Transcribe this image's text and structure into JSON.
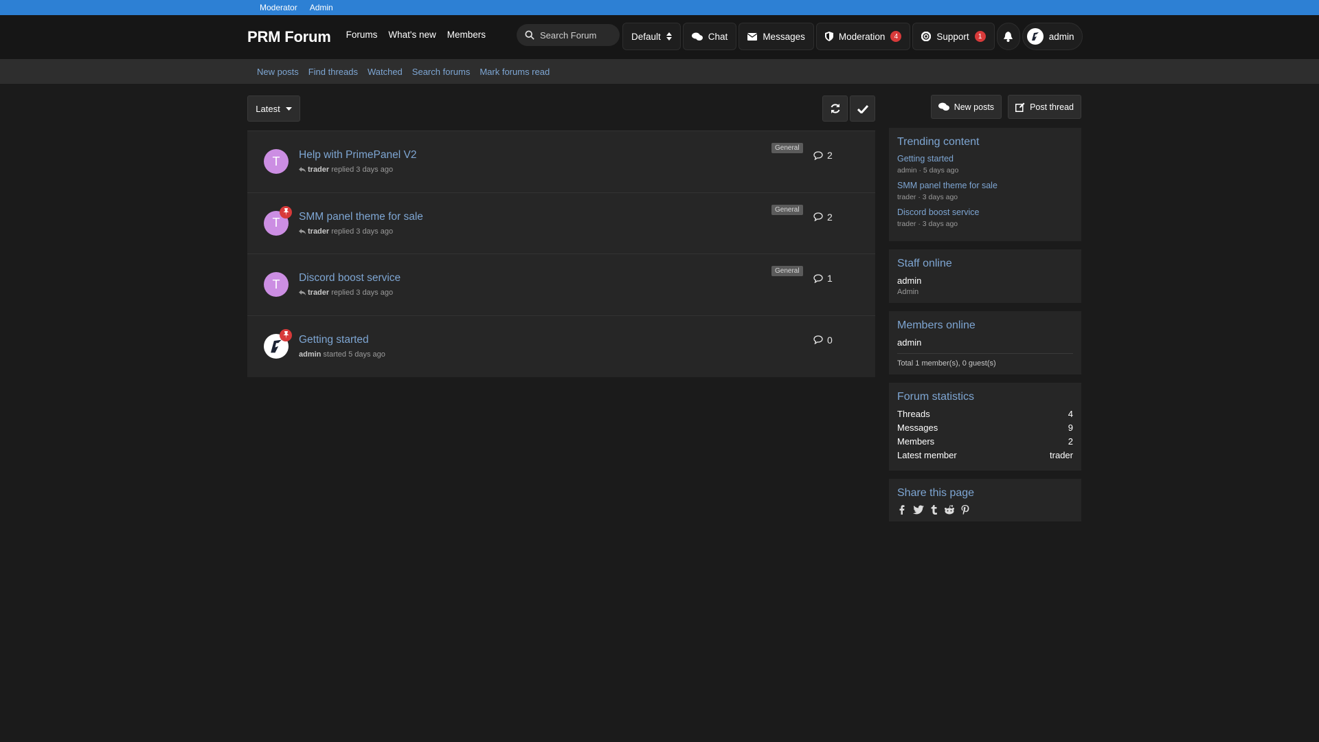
{
  "adminbar": {
    "moderator": "Moderator",
    "admin": "Admin"
  },
  "header": {
    "logo": "PRM Forum",
    "nav": [
      "Forums",
      "What's new",
      "Members"
    ],
    "search_placeholder": "Search Forum",
    "style": "Default",
    "chat": "Chat",
    "messages": "Messages",
    "moderation": "Moderation",
    "moderation_count": "4",
    "support": "Support",
    "support_count": "1",
    "user": "admin"
  },
  "subnav": [
    "New posts",
    "Find threads",
    "Watched",
    "Search forums",
    "Mark forums read"
  ],
  "toolbar": {
    "sort": "Latest"
  },
  "threads": [
    {
      "avatar": "T",
      "title": "Help with PrimePanel V2",
      "user": "trader",
      "action": "replied 3 days ago",
      "prefix": "General",
      "replies": "2"
    },
    {
      "avatar": "T",
      "title": "SMM panel theme for sale",
      "user": "trader",
      "action": "replied 3 days ago",
      "prefix": "General",
      "replies": "2"
    },
    {
      "avatar": "T",
      "title": "Discord boost service",
      "user": "trader",
      "action": "replied 3 days ago",
      "prefix": "General",
      "replies": "1"
    },
    {
      "avatar": "",
      "title": "Getting started",
      "user": "admin",
      "action": "started 5 days ago",
      "prefix": "",
      "replies": "0"
    }
  ],
  "sidebar": {
    "new_posts": "New posts",
    "post_thread": "Post thread",
    "trending": {
      "title": "Trending content",
      "items": [
        {
          "title": "Getting started",
          "meta": "admin · 5 days ago"
        },
        {
          "title": "SMM panel theme for sale",
          "meta": "trader · 3 days ago"
        },
        {
          "title": "Discord boost service",
          "meta": "trader · 3 days ago"
        }
      ]
    },
    "staff": {
      "title": "Staff online",
      "name": "admin",
      "role": "Admin"
    },
    "members": {
      "title": "Members online",
      "name": "admin",
      "total": "Total 1 member(s), 0 guest(s)"
    },
    "stats": {
      "title": "Forum statistics",
      "rows": [
        {
          "label": "Threads",
          "value": "4"
        },
        {
          "label": "Messages",
          "value": "9"
        },
        {
          "label": "Members",
          "value": "2"
        },
        {
          "label": "Latest member",
          "value": "trader"
        }
      ]
    },
    "share": {
      "title": "Share this page"
    }
  },
  "colors": {
    "accent": "#2d80d4",
    "link": "#7ea6d3",
    "badge": "#d83a3a",
    "avatar": "#cc8ee3"
  }
}
